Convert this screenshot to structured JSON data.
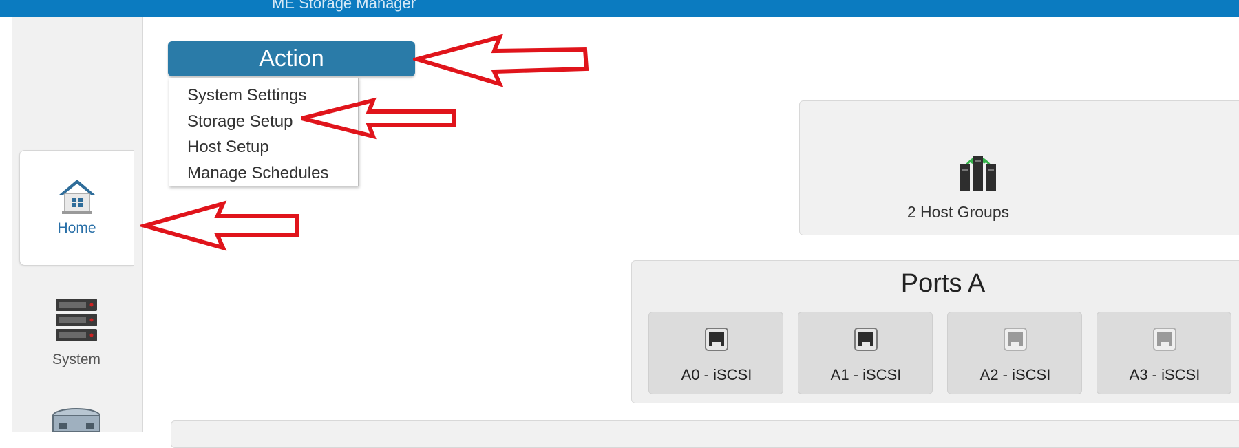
{
  "header": {
    "app_title": "ME Storage Manager",
    "bar_color": "#0b7bc0"
  },
  "sidebar": {
    "items": [
      {
        "label": "Home",
        "icon": "home-icon",
        "active": true
      },
      {
        "label": "System",
        "icon": "server-rack-icon",
        "active": false
      },
      {
        "label": "",
        "icon": "storage-icon",
        "active": false
      }
    ]
  },
  "action": {
    "button_label": "Action",
    "menu_items": [
      "System Settings",
      "Storage Setup",
      "Host Setup",
      "Manage Schedules"
    ]
  },
  "hosts": {
    "label": "2 Host Groups",
    "icon": "host-groups-icon"
  },
  "ports": {
    "title": "Ports A",
    "items": [
      {
        "label": "A0 - iSCSI",
        "icon": "ethernet-port-icon",
        "state": "active"
      },
      {
        "label": "A1 - iSCSI",
        "icon": "ethernet-port-icon",
        "state": "active"
      },
      {
        "label": "A2 - iSCSI",
        "icon": "ethernet-port-icon",
        "state": "inactive"
      },
      {
        "label": "A3 - iSCSI",
        "icon": "ethernet-port-icon",
        "state": "inactive"
      }
    ]
  },
  "annotations": {
    "arrow_color": "#e0141b"
  }
}
